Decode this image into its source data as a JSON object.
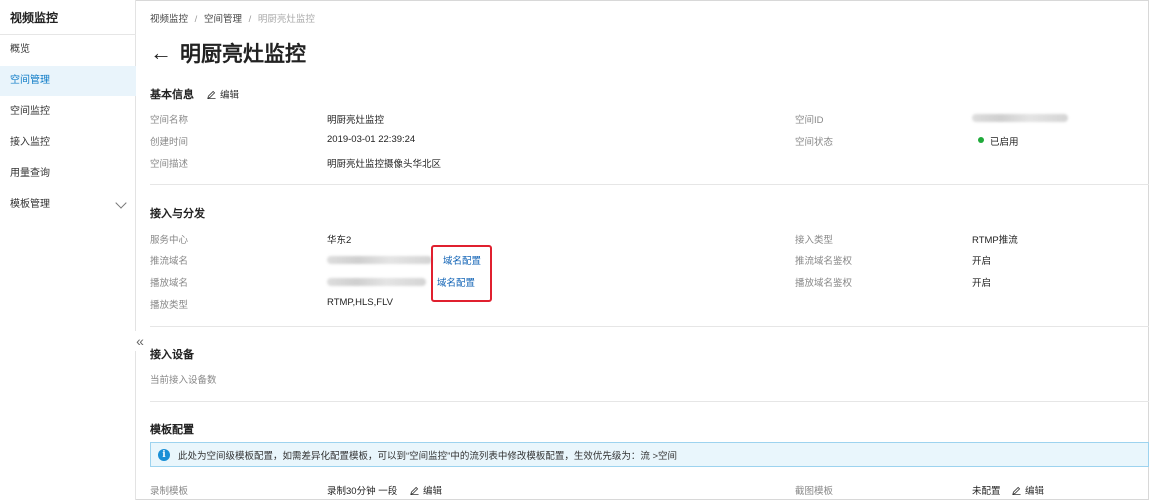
{
  "sidebar": {
    "title": "视频监控",
    "items": [
      {
        "label": "概览"
      },
      {
        "label": "空间管理"
      },
      {
        "label": "空间监控"
      },
      {
        "label": "接入监控"
      },
      {
        "label": "用量查询"
      },
      {
        "label": "模板管理"
      }
    ],
    "collapse_glyph": "«"
  },
  "breadcrumb": {
    "items": [
      "视频监控",
      "空间管理",
      "明厨亮灶监控"
    ],
    "separator": "/"
  },
  "header": {
    "back_glyph": "←",
    "title": "明厨亮灶监控"
  },
  "basic_info": {
    "title": "基本信息",
    "edit_label": "编辑",
    "space_name_label": "空间名称",
    "space_name": "明厨亮灶监控",
    "created_label": "创建时间",
    "created": "2019-03-01 22:39:24",
    "desc_label": "空间描述",
    "desc": "明厨亮灶监控摄像头华北区",
    "space_id_label": "空间ID",
    "status_label": "空间状态",
    "status": "已启用",
    "status_color": "#1faa3a"
  },
  "access": {
    "title": "接入与分发",
    "service_center_label": "服务中心",
    "service_center": "华东2",
    "push_domain_label": "推流域名",
    "push_domain_config": "域名配置",
    "play_domain_label": "播放域名",
    "play_domain_config": "域名配置",
    "play_type_label": "播放类型",
    "play_type": "RTMP,HLS,FLV",
    "access_type_label": "接入类型",
    "access_type": "RTMP推流",
    "push_auth_label": "推流域名鉴权",
    "push_auth": "开启",
    "play_auth_label": "播放域名鉴权",
    "play_auth": "开启",
    "highlight_color": "#e0202f"
  },
  "devices": {
    "title": "接入设备",
    "count_label": "当前接入设备数"
  },
  "templates": {
    "title": "模板配置",
    "notice_icon": "info-icon",
    "notice": "此处为空间级模板配置，如需差异化配置模板，可以到“空间监控”中的流列表中修改模板配置，生效优先级为：流 >空间",
    "record_label": "录制模板",
    "record_value": "录制30分钟 一段",
    "record_edit": "编辑",
    "snapshot_label": "截图模板",
    "snapshot_value": "未配置",
    "snapshot_edit": "编辑"
  },
  "colors": {
    "accent": "#0f7cc7",
    "link": "#0f62b5",
    "active_bg": "#e9f4fb",
    "notice_bg": "#e9f6fc",
    "notice_border": "#9dd3ef"
  }
}
